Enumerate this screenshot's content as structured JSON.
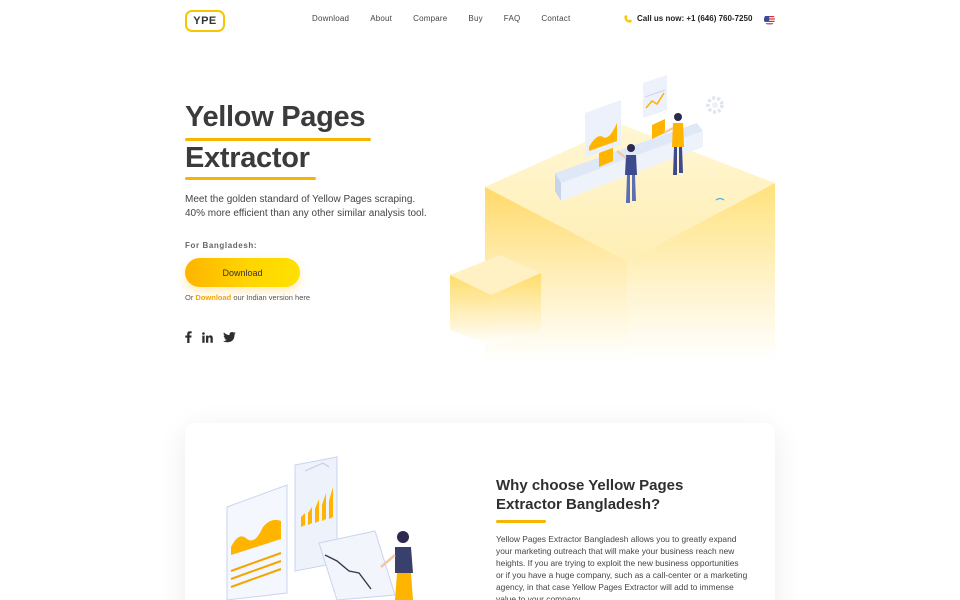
{
  "nav": {
    "logo": "YPE",
    "links": [
      "Download",
      "About",
      "Compare",
      "Buy",
      "FAQ",
      "Contact"
    ],
    "call_text": "Call us now: +1 (646) 760-7250",
    "flag": "us-flag-icon"
  },
  "hero": {
    "title_line1": "Yellow Pages",
    "title_line2": "Extractor",
    "desc_line1": "Meet the golden standard of Yellow Pages scraping.",
    "desc_line2": "40% more efficient than any other similar analysis tool.",
    "for_label": "For Bangladesh:",
    "download_label": "Download",
    "or_prefix": "Or ",
    "or_link": "Download",
    "or_suffix": " our Indian version here",
    "social": [
      "facebook-icon",
      "linkedin-icon",
      "twitter-icon"
    ]
  },
  "feature": {
    "title": "Why choose Yellow Pages Extractor Bangladesh?",
    "text": "Yellow Pages Extractor Bangladesh allows you to greatly expand your marketing outreach that will make your business reach new heights. If you are trying to exploit the new business opportunities or if you have a huge company, such as a call-center or a marketing agency, in that case Yellow Pages Extractor will add to immense value to your company."
  },
  "colors": {
    "accent": "#f7b500",
    "button_start": "#ffb400",
    "button_end": "#ffe000",
    "text_dark": "#3b3b3b"
  }
}
